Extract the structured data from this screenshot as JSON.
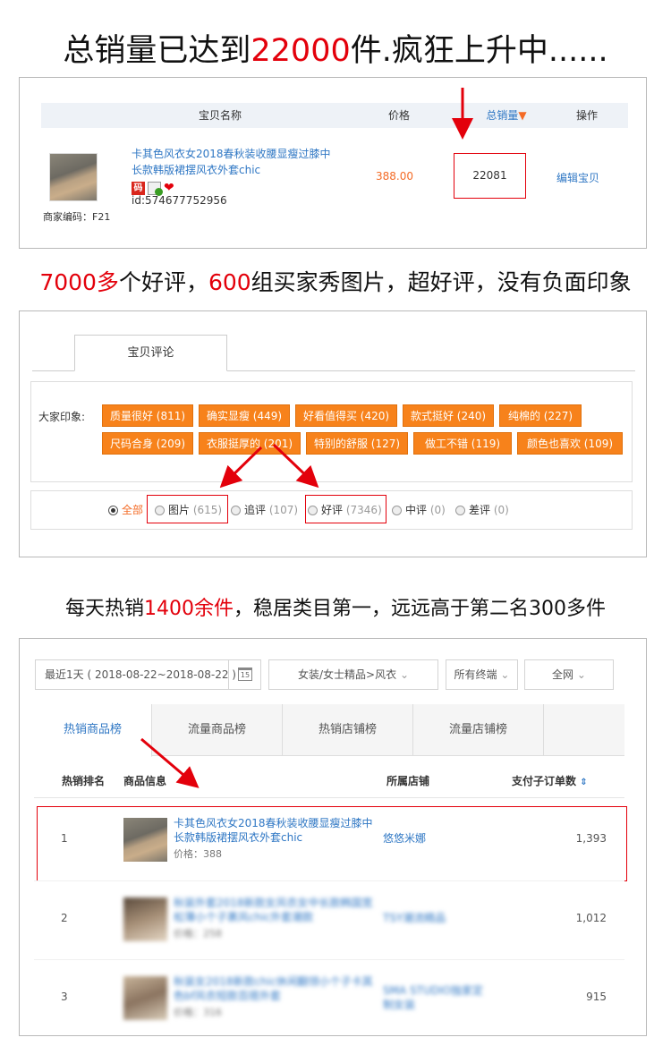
{
  "headline1": {
    "pre": "总销量已达到",
    "num": "22000",
    "post": "件.疯狂上升中......"
  },
  "panel1": {
    "headers": {
      "name": "宝贝名称",
      "price": "价格",
      "sales": "总销量",
      "action": "操作"
    },
    "product": {
      "title": "卡其色风衣女2018春秋装收腰显瘦过膝中长款韩版裙摆风衣外套chic",
      "code_badge": "码",
      "id_text": "id:574677752956",
      "merchant_code": "商家编码：F21",
      "price": "388.00",
      "sales": "22081",
      "action": "编辑宝贝"
    }
  },
  "headline2": {
    "num1": "7000多",
    "mid1": "个好评，",
    "num2": "600",
    "mid2": "组买家秀图片，超好评，没有负面印象"
  },
  "panel2": {
    "tab": "宝贝评论",
    "impressions_label": "大家印象:",
    "impressions": [
      "质量很好 (811)",
      "确实显瘦 (449)",
      "好看值得买 (420)",
      "款式挺好 (240)",
      "纯棉的 (227)",
      "尺码合身 (209)",
      "衣服挺厚的 (201)",
      "特别的舒服 (127)",
      "做工不错 (119)",
      "颜色也喜欢 (109)"
    ],
    "filters": {
      "all": "全部",
      "pic": "图片",
      "pic_count": "(615)",
      "add": "追评",
      "add_count": "(107)",
      "good": "好评",
      "good_count": "(7346)",
      "mid": "中评",
      "mid_count": "(0)",
      "bad": "差评",
      "bad_count": "(0)"
    }
  },
  "headline3": {
    "pre": "每天热销",
    "num": "1400余件",
    "post": "，稳居类目第一，远远高于第二名300多件"
  },
  "panel3": {
    "date": "最近1天 ( 2018-08-22~2018-08-22 )",
    "calendar_day": "15",
    "category": "女装/女士精品>风衣",
    "terminal": "所有终端",
    "network": "全网",
    "tabs": [
      "热销商品榜",
      "流量商品榜",
      "热销店铺榜",
      "流量店铺榜"
    ],
    "columns": {
      "rank": "热销排名",
      "info": "商品信息",
      "shop": "所属店铺",
      "orders": "支付子订单数"
    },
    "rows": [
      {
        "rank": "1",
        "title": "卡其色风衣女2018春秋装收腰显瘦过膝中长款韩版裙摆风衣外套chic",
        "price": "价格：388",
        "shop": "悠悠米娜",
        "orders": "1,393"
      },
      {
        "rank": "2",
        "title": "秋装外套2018新款女风衣女中长款韩国宽松薄小个子裹风chic外套潮款",
        "price": "价格：258",
        "shop": "TSY潮流精品",
        "orders": "1,012"
      },
      {
        "rank": "3",
        "title": "秋装女2018新款chic休闲翻领小个子卡其色bf风衣短款百搭外套",
        "price": "价格：316",
        "shop": "SMA STUDIO独家定制女装",
        "orders": "915"
      }
    ]
  },
  "colors": {
    "accent_red": "#e3000b",
    "link_blue": "#2f77c4",
    "tag_orange": "#f7821b",
    "price_orange": "#f46b26"
  }
}
